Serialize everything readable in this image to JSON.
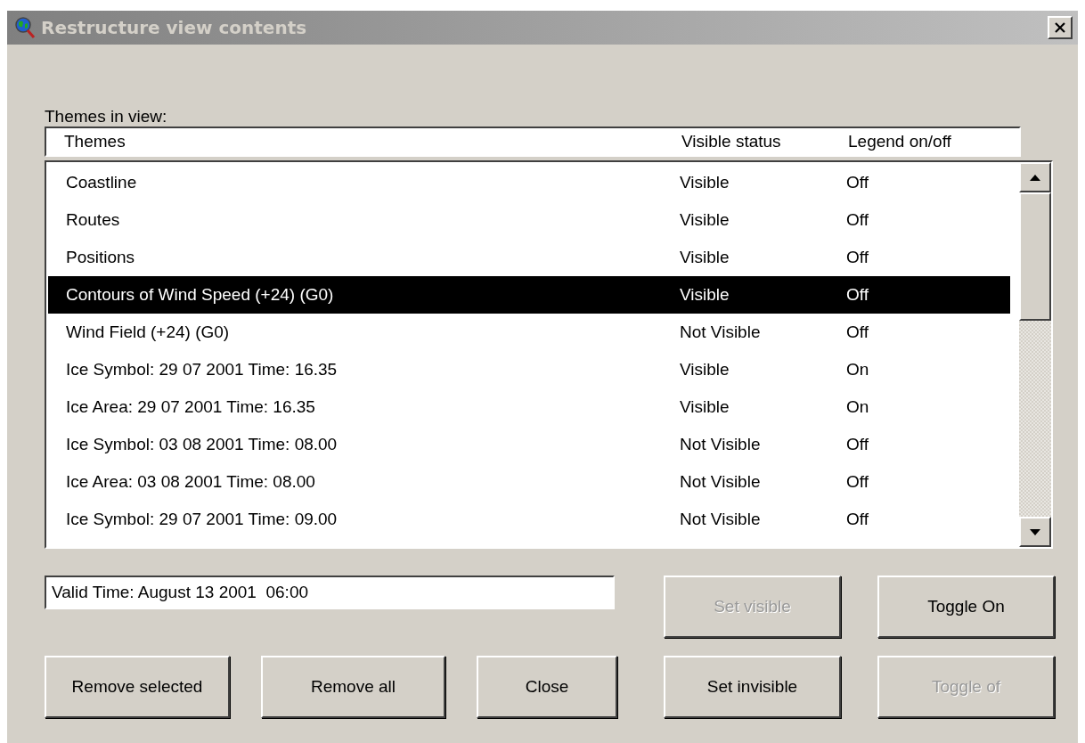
{
  "window": {
    "title": "Restructure view contents"
  },
  "themes_label": "Themes in view:",
  "table": {
    "columns": [
      "Themes",
      "Visible status",
      "Legend on/off"
    ],
    "rows": [
      {
        "cells": [
          "Coastline",
          "Visible",
          "Off"
        ],
        "selected": false
      },
      {
        "cells": [
          "Routes",
          "Visible",
          "Off"
        ],
        "selected": false
      },
      {
        "cells": [
          "Positions",
          "Visible",
          "Off"
        ],
        "selected": false
      },
      {
        "cells": [
          "Contours of Wind Speed (+24) (G0)",
          "Visible",
          "Off"
        ],
        "selected": true
      },
      {
        "cells": [
          "Wind Field (+24) (G0)",
          "Not Visible",
          "Off"
        ],
        "selected": false
      },
      {
        "cells": [
          "Ice Symbol: 29 07 2001 Time: 16.35",
          "Visible",
          "On"
        ],
        "selected": false
      },
      {
        "cells": [
          "Ice Area: 29 07 2001 Time: 16.35",
          "Visible",
          "On"
        ],
        "selected": false
      },
      {
        "cells": [
          "Ice Symbol: 03 08 2001 Time: 08.00",
          "Not Visible",
          "Off"
        ],
        "selected": false
      },
      {
        "cells": [
          "Ice Area: 03 08 2001 Time: 08.00",
          "Not Visible",
          "Off"
        ],
        "selected": false
      },
      {
        "cells": [
          "Ice Symbol: 29 07 2001 Time: 09.00",
          "Not Visible",
          "Off"
        ],
        "selected": false
      }
    ]
  },
  "valid_time": {
    "value": "Valid Time: August 13 2001  06:00"
  },
  "buttons_top": [
    {
      "label": "Set visible",
      "disabled": true
    },
    {
      "label": "Toggle On",
      "disabled": false
    }
  ],
  "buttons_bottom": [
    {
      "label": "Remove selected",
      "disabled": false
    },
    {
      "label": "Remove all",
      "disabled": false
    },
    {
      "label": "Close",
      "disabled": false
    },
    {
      "label": "Set invisible",
      "disabled": false
    },
    {
      "label": "Toggle of",
      "disabled": true
    }
  ]
}
